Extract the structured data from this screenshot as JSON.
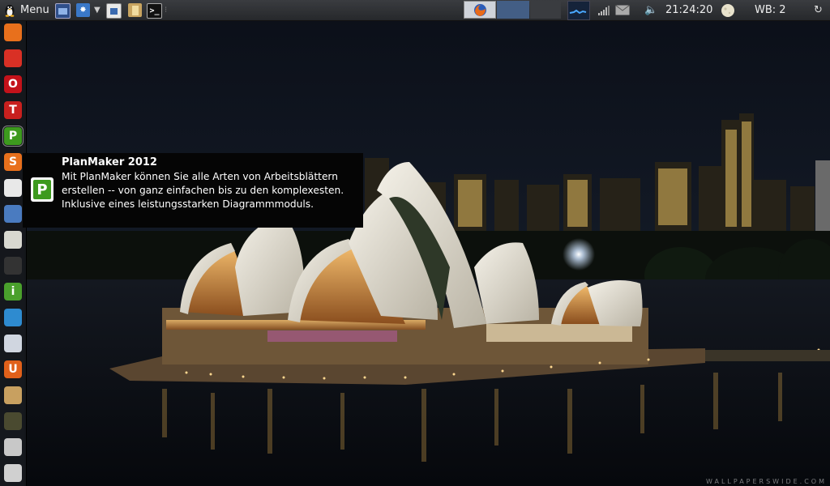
{
  "top_panel": {
    "menu_label": "Menu",
    "clock": "21:24:20",
    "workspace": "WB: 2"
  },
  "tooltip": {
    "title": "PlanMaker 2012",
    "description": "Mit PlanMaker können Sie alle Arten von Arbeitsblättern erstellen -- von ganz einfachen bis zu den komplexesten. Inklusive eines leistungsstarken Diagrammmoduls."
  },
  "launcher": {
    "items": [
      {
        "icon": "office-suite-icon",
        "glyph": "",
        "color": "#e8701c"
      },
      {
        "icon": "chrome-icon",
        "glyph": "",
        "color": "#d93025"
      },
      {
        "icon": "opera-icon",
        "glyph": "O",
        "color": "#c4121a"
      },
      {
        "icon": "textmaker-icon",
        "glyph": "T",
        "color": "#c8201e"
      },
      {
        "icon": "planmaker-icon",
        "glyph": "P",
        "color": "#3d9a1e"
      },
      {
        "icon": "presentations-icon",
        "glyph": "S",
        "color": "#e8701c"
      },
      {
        "icon": "acrobat-icon",
        "glyph": "",
        "color": "#e8e8e8"
      },
      {
        "icon": "calendar-icon",
        "glyph": "",
        "color": "#4a7bc0"
      },
      {
        "icon": "calculator-icon",
        "glyph": "",
        "color": "#d8d8d0"
      },
      {
        "icon": "camera-icon",
        "glyph": "",
        "color": "#333333"
      },
      {
        "icon": "info-icon",
        "glyph": "i",
        "color": "#4aa02c"
      },
      {
        "icon": "presentation-board-icon",
        "glyph": "",
        "color": "#2e8bd0"
      },
      {
        "icon": "disk-usage-icon",
        "glyph": "",
        "color": "#d0d6e0"
      },
      {
        "icon": "ubuntu-one-icon",
        "glyph": "U",
        "color": "#e0601a"
      },
      {
        "icon": "package-install-icon",
        "glyph": "",
        "color": "#c8a060"
      },
      {
        "icon": "system-monitor-icon",
        "glyph": "",
        "color": "#4a4a30"
      },
      {
        "icon": "mixer-icon",
        "glyph": "",
        "color": "#c8c8c8"
      },
      {
        "icon": "trash-icon",
        "glyph": "",
        "color": "#d0d0d0"
      }
    ]
  },
  "wallpaper": {
    "watermark": "WALLPAPERSWIDE.COM"
  }
}
